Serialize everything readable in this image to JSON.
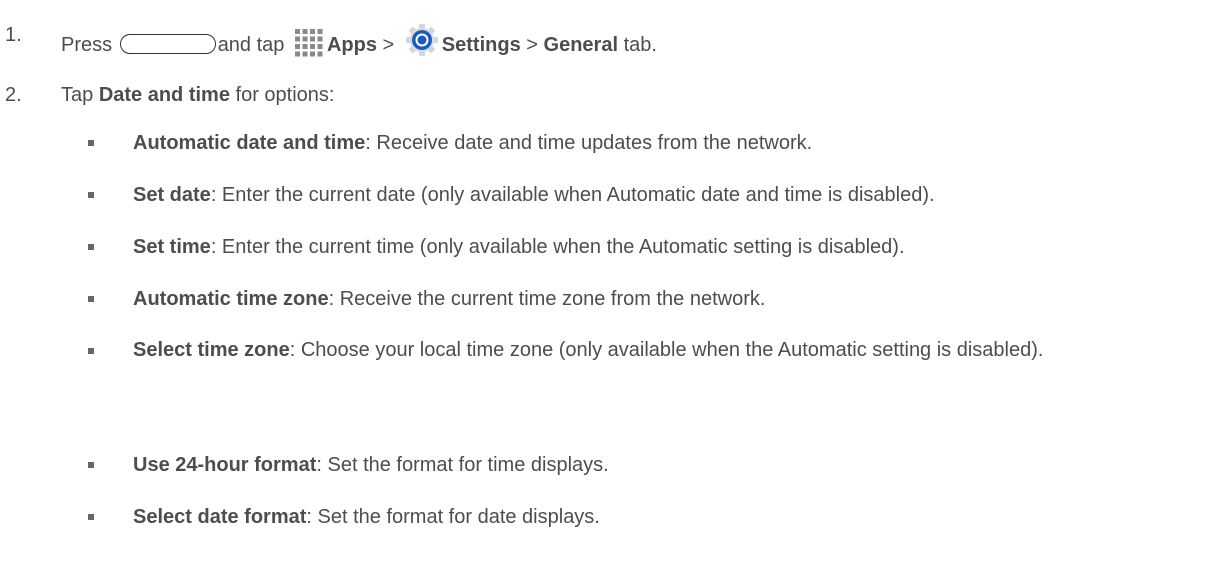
{
  "step1": {
    "number": "1.",
    "press": "Press",
    "and_tap": "and tap",
    "apps": "Apps",
    "sep1": ">",
    "settings": "Settings",
    "sep2": ">",
    "general": "General",
    "tab": "tab.",
    "icons": [
      "home-key",
      "apps-grid-icon",
      "settings-gear-icon"
    ]
  },
  "step2": {
    "number": "2.",
    "tap": "Tap",
    "item": "Date and time",
    "suffix": "for options:"
  },
  "options": [
    {
      "term": "Automatic date and time",
      "desc": ": Receive date and time updates from the network."
    },
    {
      "term": "Set date",
      "desc": ": Enter the current date (only available when Automatic date and time is disabled)."
    },
    {
      "term": "Set time",
      "desc": ": Enter the current time (only available when the Automatic setting is disabled)."
    },
    {
      "term": "Automatic time zone",
      "desc": ": Receive the current time zone from the network."
    },
    {
      "term": "Select time zone",
      "desc": ": Choose your local time zone (only available when the Automatic setting is disabled)."
    },
    {
      "term": "Use 24-hour format",
      "desc": ": Set the format for time displays."
    },
    {
      "term": "Select date format",
      "desc": ": Set the format for date displays."
    }
  ],
  "colors": {
    "text": "#4d4d4d",
    "settings_icon": "#1e5bbf"
  }
}
